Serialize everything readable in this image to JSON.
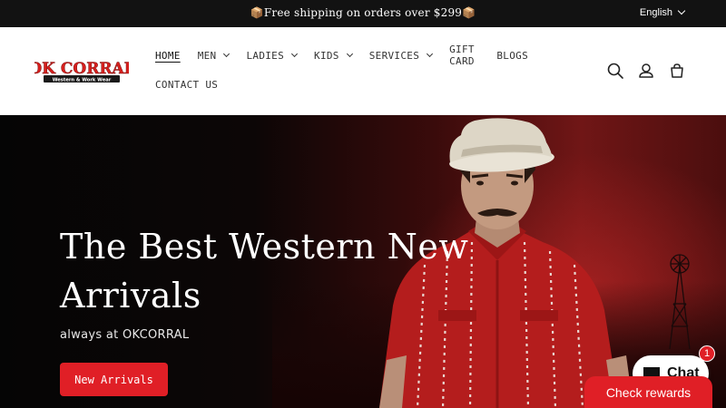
{
  "announcement": {
    "message": "📦Free shipping on orders over $299📦",
    "language": "English"
  },
  "logo": {
    "brand": "OK CORRAL",
    "tagline": "Western & Work Wear"
  },
  "nav": {
    "row1": [
      {
        "label": "HOME",
        "has_dropdown": false,
        "active": true
      },
      {
        "label": "MEN",
        "has_dropdown": true
      },
      {
        "label": "LADIES",
        "has_dropdown": true
      },
      {
        "label": "KIDS",
        "has_dropdown": true
      },
      {
        "label": "SERVICES",
        "has_dropdown": true
      },
      {
        "label": "GIFT CARD",
        "has_dropdown": false
      },
      {
        "label": "BLOGS",
        "has_dropdown": false
      }
    ],
    "row2": [
      {
        "label": "CONTACT US",
        "has_dropdown": false
      }
    ]
  },
  "header_icons": [
    "search-icon",
    "account-icon",
    "cart-icon"
  ],
  "hero": {
    "title": "The Best Western New Arrivals",
    "subtitle": "always at OKCORRAL",
    "cta_label": "New Arrivals"
  },
  "chat": {
    "label": "Chat",
    "badge_count": "1"
  },
  "rewards": {
    "label": "Check rewards"
  },
  "colors": {
    "accent": "#e01f26",
    "topbar": "#121212",
    "hero_red": "#701616"
  }
}
